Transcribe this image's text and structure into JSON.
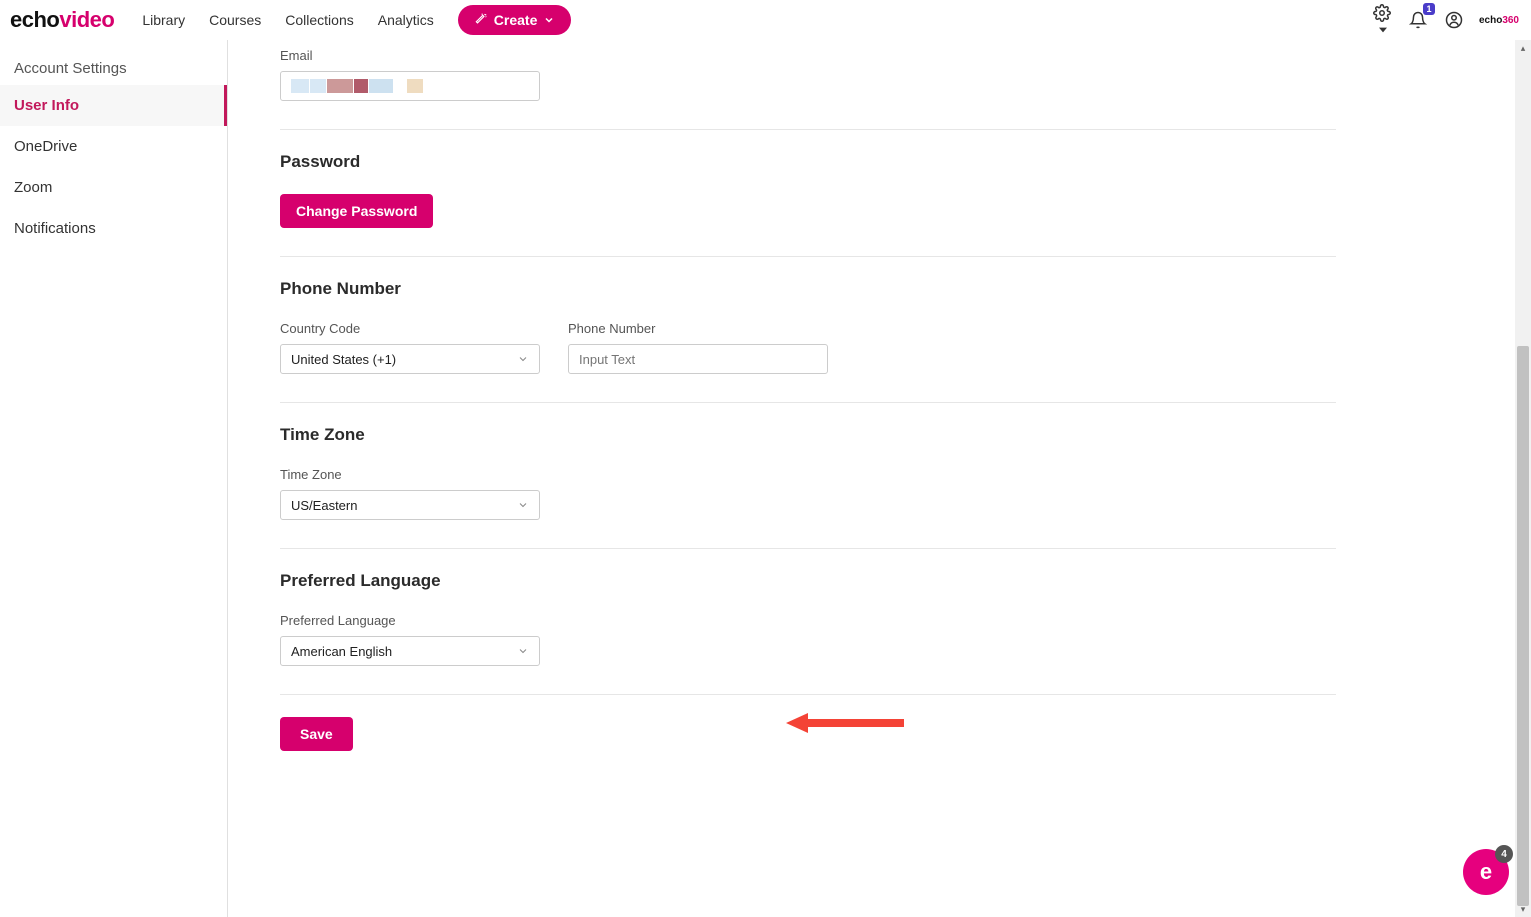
{
  "header": {
    "logo_part1": "echo",
    "logo_part2": "video",
    "nav": [
      "Library",
      "Courses",
      "Collections",
      "Analytics"
    ],
    "create_label": "Create",
    "notif_count": "1",
    "mini_brand1": "echo",
    "mini_brand2": "360"
  },
  "sidebar": {
    "title": "Account Settings",
    "items": [
      "User Info",
      "OneDrive",
      "Zoom",
      "Notifications"
    ],
    "active_index": 0
  },
  "sections": {
    "email": {
      "label": "Email"
    },
    "password": {
      "title": "Password",
      "button": "Change Password"
    },
    "phone": {
      "title": "Phone Number",
      "country_label": "Country Code",
      "country_value": "United States (+1)",
      "number_label": "Phone Number",
      "number_placeholder": "Input Text"
    },
    "timezone": {
      "title": "Time Zone",
      "label": "Time Zone",
      "value": "US/Eastern"
    },
    "language": {
      "title": "Preferred Language",
      "label": "Preferred Language",
      "value": "American English"
    },
    "save_label": "Save"
  },
  "fab": {
    "letter": "e",
    "count": "4"
  }
}
